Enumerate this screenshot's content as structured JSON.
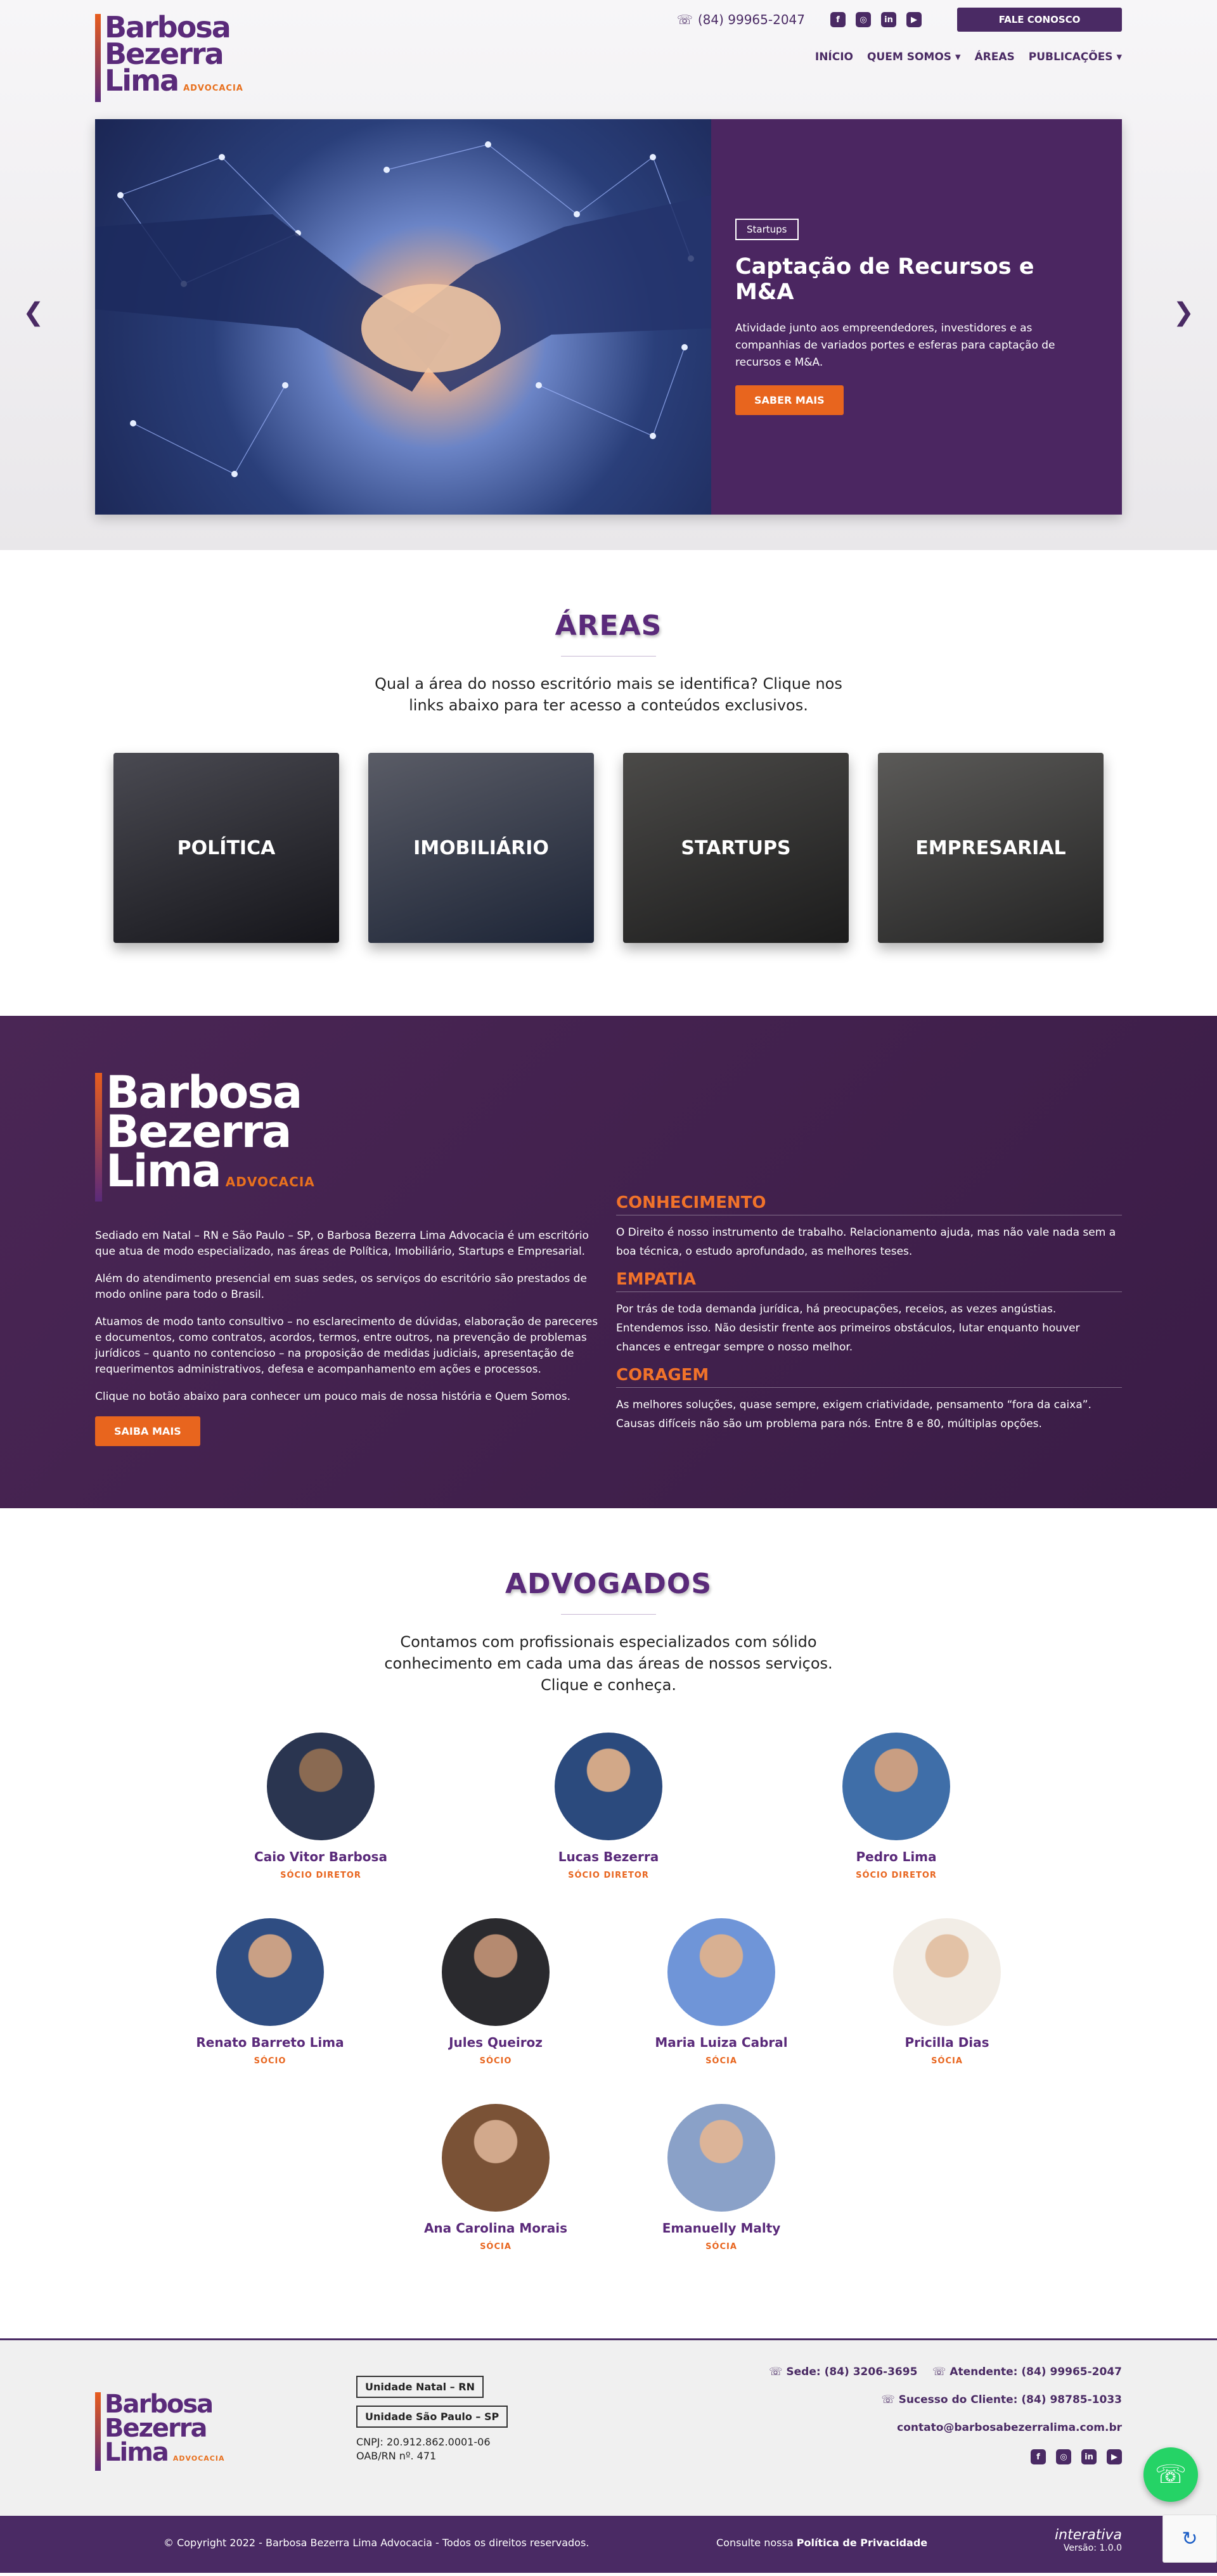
{
  "header": {
    "phone": "(84) 99965-2047",
    "cta": "FALE CONOSCO",
    "nav": [
      "INÍCIO",
      "QUEM SOMOS",
      "ÁREAS",
      "PUBLICAÇÕES"
    ],
    "logo": {
      "line1": "Barbosa",
      "line2": "Bezerra",
      "line3": "Lima",
      "tagline": "ADVOCACIA"
    }
  },
  "hero": {
    "tag": "Startups",
    "title": "Captação de Recursos e M&A",
    "description": "Atividade junto aos empreendedores, investidores e as companhias de variados portes e esferas para captação de recursos e M&A.",
    "button": "SABER MAIS"
  },
  "areas": {
    "title": "ÁREAS",
    "subtitle_1": "Qual a área do nosso escritório mais se identifica? Clique nos",
    "subtitle_2": "links abaixo para ter acesso a conteúdos exclusivos.",
    "cards": [
      "POLÍTICA",
      "IMOBILIÁRIO",
      "STARTUPS",
      "EMPRESARIAL"
    ]
  },
  "about": {
    "p1": "Sediado em Natal – RN e São Paulo – SP, o Barbosa Bezerra Lima Advocacia é um escritório que atua de modo especializado, nas áreas de Política, Imobiliário, Startups e Empresarial.",
    "p2": "Além do atendimento presencial em suas sedes, os serviços do escritório são prestados de modo online para todo o Brasil.",
    "p3": "Atuamos de modo tanto consultivo – no esclarecimento de dúvidas, elaboração de pareceres e documentos, como contratos, acordos, termos, entre outros, na prevenção de problemas jurídicos – quanto no contencioso – na proposição de medidas judiciais, apresentação de requerimentos administrativos, defesa e acompanhamento em ações e processos.",
    "p4": "Clique no botão abaixo para conhecer um pouco mais de nossa história e Quem Somos.",
    "button": "SAIBA MAIS",
    "values": [
      {
        "title": "CONHECIMENTO",
        "text": "O Direito é nosso instrumento de trabalho. Relacionamento ajuda, mas não vale nada sem a boa técnica, o estudo aprofundado, as melhores teses."
      },
      {
        "title": "EMPATIA",
        "text": "Por trás de toda demanda jurídica, há preocupações, receios, as vezes angústias. Entendemos isso. Não desistir frente aos primeiros obstáculos, lutar enquanto houver chances e entregar sempre o nosso melhor."
      },
      {
        "title": "CORAGEM",
        "text": "As melhores soluções, quase sempre, exigem criatividade, pensamento “fora da caixa”. Causas difíceis não são um problema para nós. Entre 8 e 80, múltiplas opções."
      }
    ]
  },
  "team": {
    "title": "ADVOGADOS",
    "subtitle_1": "Contamos com profissionais especializados com sólido",
    "subtitle_2": "conhecimento em cada uma das áreas de nossos serviços.",
    "subtitle_3": "Clique e conheça.",
    "row1": [
      {
        "name": "Caio Vitor Barbosa",
        "role": "SÓCIO DIRETOR"
      },
      {
        "name": "Lucas Bezerra",
        "role": "SÓCIO DIRETOR"
      },
      {
        "name": "Pedro Lima",
        "role": "SÓCIO DIRETOR"
      }
    ],
    "row2": [
      {
        "name": "Renato Barreto Lima",
        "role": "SÓCIO"
      },
      {
        "name": "Jules Queiroz",
        "role": "SÓCIO"
      },
      {
        "name": "Maria Luiza Cabral",
        "role": "SÓCIA"
      },
      {
        "name": "Pricilla Dias",
        "role": "SÓCIA"
      }
    ],
    "row3": [
      {
        "name": "Ana Carolina Morais",
        "role": "SÓCIA"
      },
      {
        "name": "Emanuelly Malty",
        "role": "SÓCIA"
      }
    ]
  },
  "footer": {
    "unit1": "Unidade Natal – RN",
    "unit2": "Unidade São Paulo – SP",
    "cnpj": "CNPJ: 20.912.862.0001-06",
    "oab": "OAB/RN nº. 471",
    "sede": "Sede: (84) 3206-3695",
    "atendente": "Atendente: (84) 99965-2047",
    "sucesso": "Sucesso do Cliente: (84) 98785-1033",
    "email": "contato@barbosabezerralima.com.br",
    "copyright": "© Copyright 2022 - Barbosa Bezerra Lima Advocacia - Todos os direitos reservados.",
    "privacy_prefix": "Consulte nossa",
    "privacy_link": "Política de Privacidade",
    "brand": "interativa",
    "version": "Versão: 1.0.0"
  }
}
